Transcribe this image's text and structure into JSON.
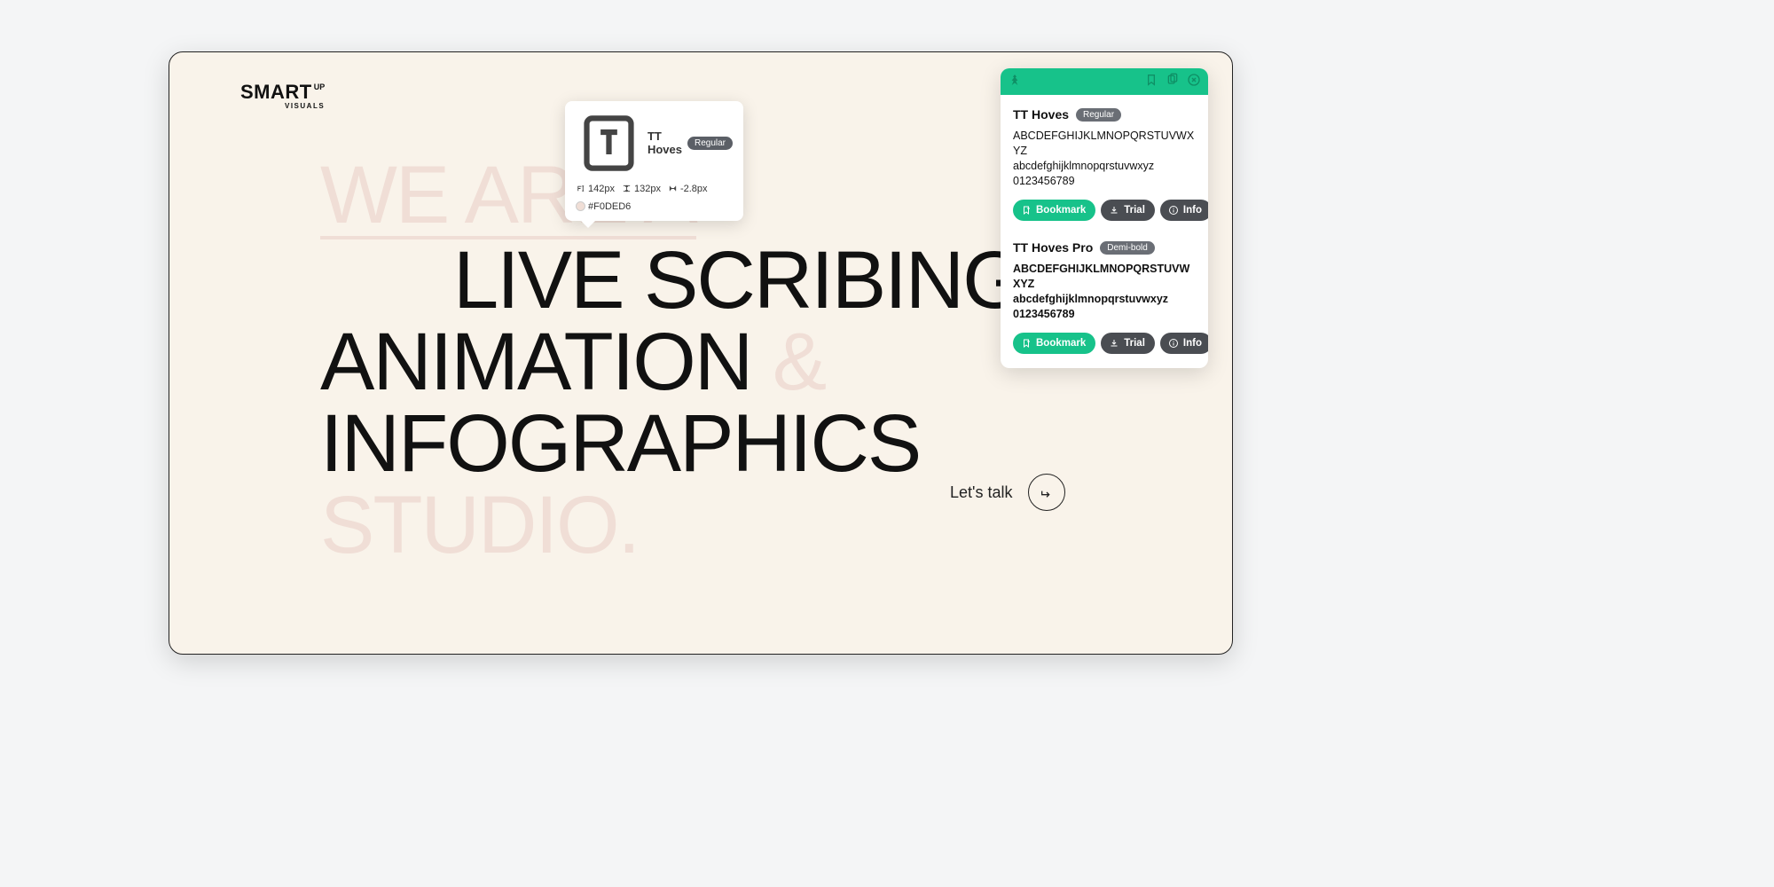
{
  "logo": {
    "main": "SMART",
    "sup": "UP",
    "sub": "VISUALS"
  },
  "hero": {
    "line1": "WE ARE A",
    "line2": "LIVE SCRIBING",
    "line3a": "ANIMATION ",
    "line3amp": "&",
    "line4": "INFOGRAPHICS",
    "line5": "STUDIO."
  },
  "cta": {
    "label": "Let's talk"
  },
  "tooltip": {
    "font_name": "TT Hoves",
    "weight": "Regular",
    "font_size": "142px",
    "line_height": "132px",
    "letter_spacing": "-2.8px",
    "color_hex": "#F0DED6"
  },
  "panel": {
    "fonts": [
      {
        "name": "TT Hoves",
        "weight": "Regular",
        "specimen_upper": "ABCDEFGHIJKLMNOPQRSTUVWXYZ",
        "specimen_lower": "abcdefghijklmnopqrstuvwxyz",
        "specimen_digits": "0123456789",
        "bold": false,
        "buttons": {
          "bookmark": "Bookmark",
          "trial": "Trial",
          "info": "Info"
        }
      },
      {
        "name": "TT Hoves Pro",
        "weight": "Demi-bold",
        "specimen_upper": "ABCDEFGHIJKLMNOPQRSTUVWXYZ",
        "specimen_lower": "abcdefghijklmnopqrstuvwxyz",
        "specimen_digits": "0123456789",
        "bold": true,
        "buttons": {
          "bookmark": "Bookmark",
          "trial": "Trial",
          "info": "Info"
        }
      }
    ]
  }
}
